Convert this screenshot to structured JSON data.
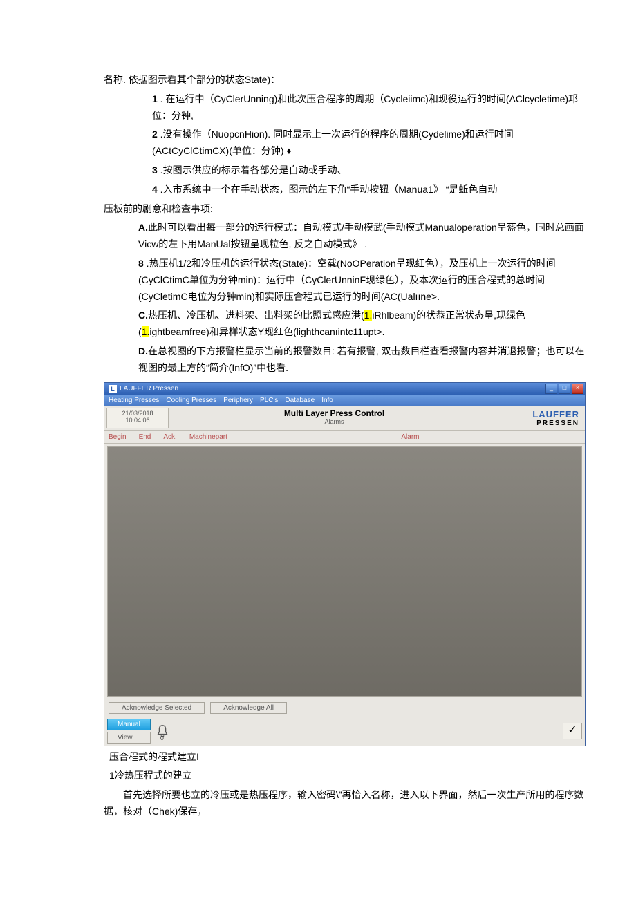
{
  "doc": {
    "intro": "名称. 依据图示看其个部分的状态State)：",
    "items": [
      {
        "num": "1",
        "text": " . 在运行中（CyClerUnning)和此次压合程序的周期（Cycleiimc)和现役运行的时间(AClcycletime)邛位：分钟,"
      },
      {
        "num": "2",
        "text": " .没有操作（NuopcnHion). 同时显示上一次运行的程序的周期(Cydelime)和运行时间(ACtCyClCtimCX)(单位：分钟) ♦"
      },
      {
        "num": "3",
        "text": " .按图示供应的标示着各部分是自动或手动、"
      },
      {
        "num": "4",
        "text": " .入市系统中一个在手动状态，图示的左下角“手动按钮（Manua1》 “是蚯色自动"
      }
    ],
    "followup": "压板前的剧意和检查事项:",
    "sub": [
      {
        "label": "A.",
        "text": "此时可以看出每一部分的运行模式：自动模式/手动模武(手动模式Manualoperation呈盔色，同时总画面Vicw的左下用ManUal按钮呈现粒色, 反之自动模式》 ."
      },
      {
        "label": "8",
        "text": " .热压机1/2和冷压机的运行状态(State)：空载(NoOPeration呈现红色），及压机上一次运行的时间(CyClCtimC单位为分钟min)：运行中（CyClerUnninF现绿色），及本次运行的压合程式的总时间(CyCletimC电位为分钟min)和实际压合程式已运行的时间(AC(Ualııne>."
      },
      {
        "label": "C.",
        "pre": "热压机、冷压机、进料架、出料架的比照式感应港(",
        "hl1": "1.",
        "mid1": "iRhlbeam)的状恭正常状态呈,现绿色(",
        "hl2": "1.",
        "mid2": "ightbeamfree)和异样状态Y现红色(lighthcanıintc11upt>."
      },
      {
        "label": "D.",
        "text": "在总视图的下方报警栏显示当前的报警数目: 若有报警, 双击数目栏查看报警内容并消退报警；也可以在视图的最上方的“简介(InfO)”中也看."
      }
    ],
    "after": {
      "line1": "压合程式的程式建立I",
      "line2": "1冷热压程式的建立",
      "line3": "首先选择所要也立的冷压或是热压程序，输入密码\\”再恰入名称，进入以下界面，然后一次生产所用的程序数据，核对（Chek)保存，"
    }
  },
  "app": {
    "title": "LAUFFER Pressen",
    "menu": [
      "Heating Presses",
      "Cooling Presses",
      "Periphery",
      "PLC's",
      "Database",
      "Info"
    ],
    "datetime": {
      "date": "21/03/2018",
      "time": "10:04:06"
    },
    "header": {
      "main": "Multi Layer Press Control",
      "sub": "Alarms"
    },
    "logo": {
      "l1": "LAUFFER",
      "l2": "PRESSEN"
    },
    "cols": {
      "c1": "Begin",
      "c2": "End",
      "c3": "Ack.",
      "c4": "Machinepart",
      "c5": "Alarm"
    },
    "ack": {
      "sel": "Acknowledge Selected",
      "all": "Acknowledge All"
    },
    "bottom": {
      "manual": "Manual",
      "view": "View",
      "bellcount": "0",
      "check": "✓"
    },
    "winbtns": {
      "min": "_",
      "max": "□",
      "close": "×"
    }
  }
}
